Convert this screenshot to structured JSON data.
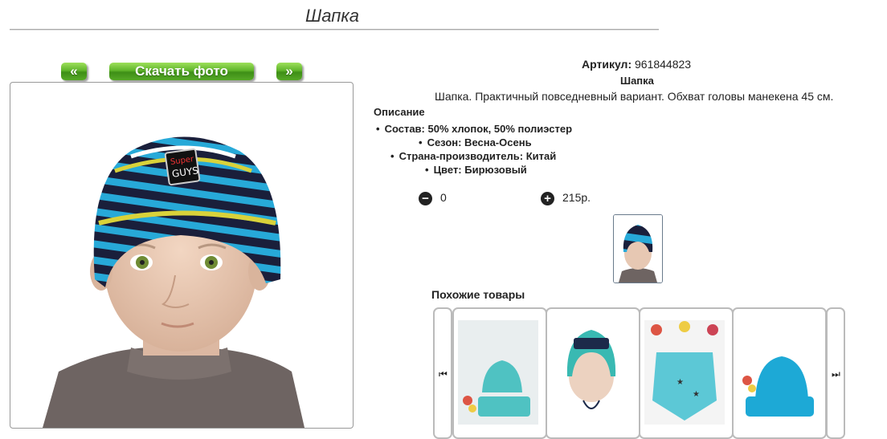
{
  "page": {
    "title": "Шапка"
  },
  "photo_nav": {
    "prev_label": "«",
    "download_label": "Скачать фото",
    "next_label": "»"
  },
  "product": {
    "sku_label": "Артикул:",
    "sku_value": "961844823",
    "name": "Шапка",
    "description": "Шапка. Практичный повседневный вариант. Обхват головы манекена 45 см.",
    "description_heading": "Описание",
    "features": [
      "Состав: 50% хлопок, 50% полиэстер",
      "Сезон: Весна-Осень",
      "Страна-производитель: Китай",
      "Цвет: Бирюзовый"
    ],
    "quantity": "0",
    "price": "215р."
  },
  "similar": {
    "heading": "Похожие товары",
    "items": [
      {
        "name": "hat-with-bag",
        "color": "#4fc2c2"
      },
      {
        "name": "nike-bonnet",
        "color": "#39b9b2"
      },
      {
        "name": "bandana-stars",
        "color": "#5cc8d6"
      },
      {
        "name": "hat-turquoise",
        "color": "#1da9d6"
      }
    ]
  },
  "icons": {
    "minus": "minus-circle-icon",
    "plus": "plus-circle-icon",
    "first": "skip-back-icon",
    "last": "skip-forward-icon"
  }
}
